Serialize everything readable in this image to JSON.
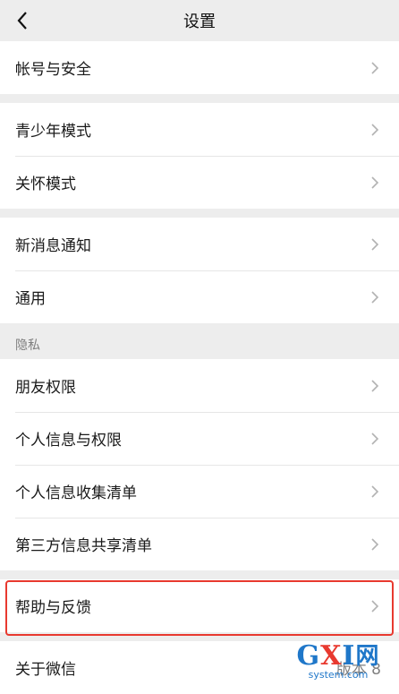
{
  "header": {
    "title": "设置"
  },
  "groups": {
    "account": [
      {
        "label": "帐号与安全"
      }
    ],
    "modes": [
      {
        "label": "青少年模式"
      },
      {
        "label": "关怀模式"
      }
    ],
    "general": [
      {
        "label": "新消息通知"
      },
      {
        "label": "通用"
      }
    ],
    "privacy_header": "隐私",
    "privacy": [
      {
        "label": "朋友权限"
      },
      {
        "label": "个人信息与权限"
      },
      {
        "label": "个人信息收集清单"
      },
      {
        "label": "第三方信息共享清单"
      }
    ],
    "help": [
      {
        "label": "帮助与反馈"
      }
    ],
    "about": [
      {
        "label": "关于微信",
        "value": "版本 8"
      }
    ]
  },
  "watermark": {
    "brand": "GXI网",
    "domain": "system.com"
  },
  "colors": {
    "highlight": "#e8392f",
    "background": "#ededed",
    "watermark_blue": "#1f77c9"
  }
}
